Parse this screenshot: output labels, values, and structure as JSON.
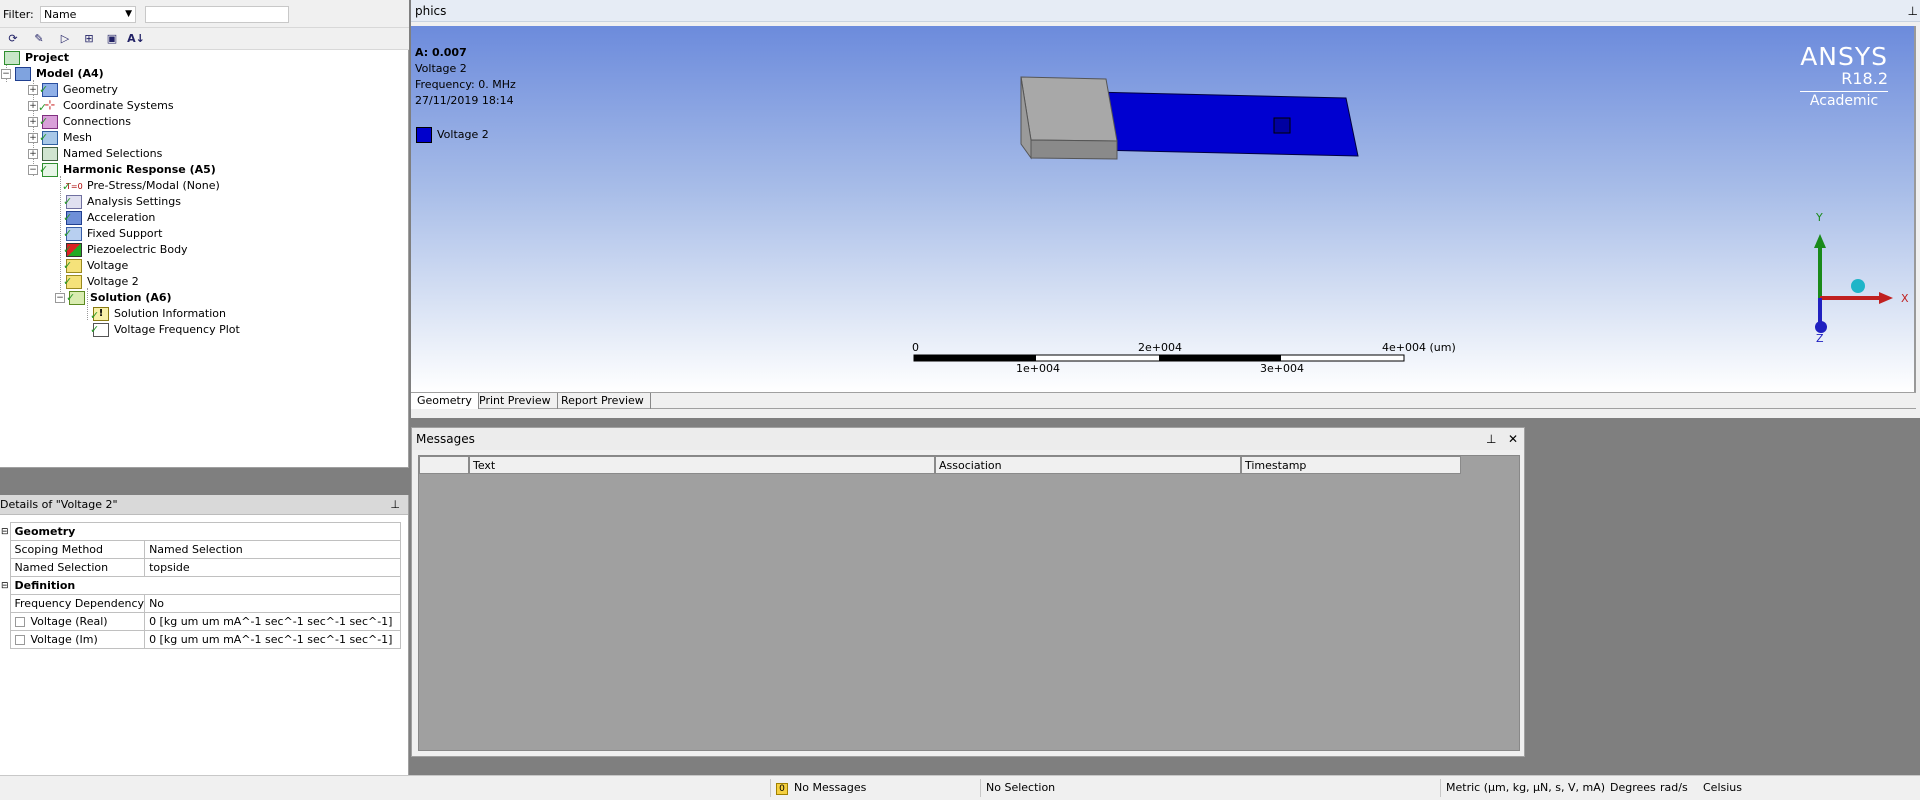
{
  "filter": {
    "label": "Filter:",
    "selected": "Name",
    "text": ""
  },
  "tree": {
    "project": "Project",
    "model": "Model (A4)",
    "geometry": "Geometry",
    "coordinate_systems": "Coordinate Systems",
    "connections": "Connections",
    "mesh": "Mesh",
    "named_selections": "Named Selections",
    "harmonic": "Harmonic Response (A5)",
    "prestress": "Pre-Stress/Modal (None)",
    "analysis_settings": "Analysis Settings",
    "acceleration": "Acceleration",
    "fixed_support": "Fixed Support",
    "piezo_body": "Piezoelectric Body",
    "voltage": "Voltage",
    "voltage2": "Voltage 2",
    "solution": "Solution (A6)",
    "solution_info": "Solution Information",
    "voltage_freq_plot": "Voltage Frequency Plot"
  },
  "details": {
    "title": "Details of \"Voltage 2\"",
    "group_geometry": "Geometry",
    "scoping_method_label": "Scoping Method",
    "scoping_method_value": "Named Selection",
    "named_selection_label": "Named Selection",
    "named_selection_value": "topside",
    "group_definition": "Definition",
    "freq_dep_label": "Frequency Dependency",
    "freq_dep_value": "No",
    "voltage_real_label": "Voltage (Real)",
    "voltage_real_value": "0 [kg um um mA^-1 sec^-1 sec^-1 sec^-1]",
    "voltage_im_label": "Voltage (Im)",
    "voltage_im_value": "0 [kg um um mA^-1 sec^-1 sec^-1 sec^-1]"
  },
  "graphics": {
    "title": "phics",
    "info_a": "A: 0.007",
    "info_name": "Voltage 2",
    "info_freq": "Frequency: 0. MHz",
    "info_date": "27/11/2019 18:14",
    "legend_label": "Voltage 2",
    "legend_color": "#0000cc",
    "ansys_name": "ANSYS",
    "ansys_version": "R18.2",
    "ansys_edition": "Academic",
    "scale_0": "0",
    "scale_2": "2e+004",
    "scale_4": "4e+004 (um)",
    "scale_1": "1e+004",
    "scale_3": "3e+004",
    "axis_y": "Y",
    "axis_x": "X",
    "axis_z": "Z",
    "tabs": [
      "Geometry",
      "Print Preview",
      "Report Preview"
    ]
  },
  "messages": {
    "title": "Messages",
    "columns": [
      "",
      "Text",
      "Association",
      "Timestamp"
    ]
  },
  "status": {
    "messages_count": "0",
    "messages": "No Messages",
    "selection": "No Selection",
    "units": "Metric (µm, kg, µN, s, V, mA)",
    "angle": "Degrees",
    "rate": "rad/s",
    "temp": "Celsius"
  }
}
